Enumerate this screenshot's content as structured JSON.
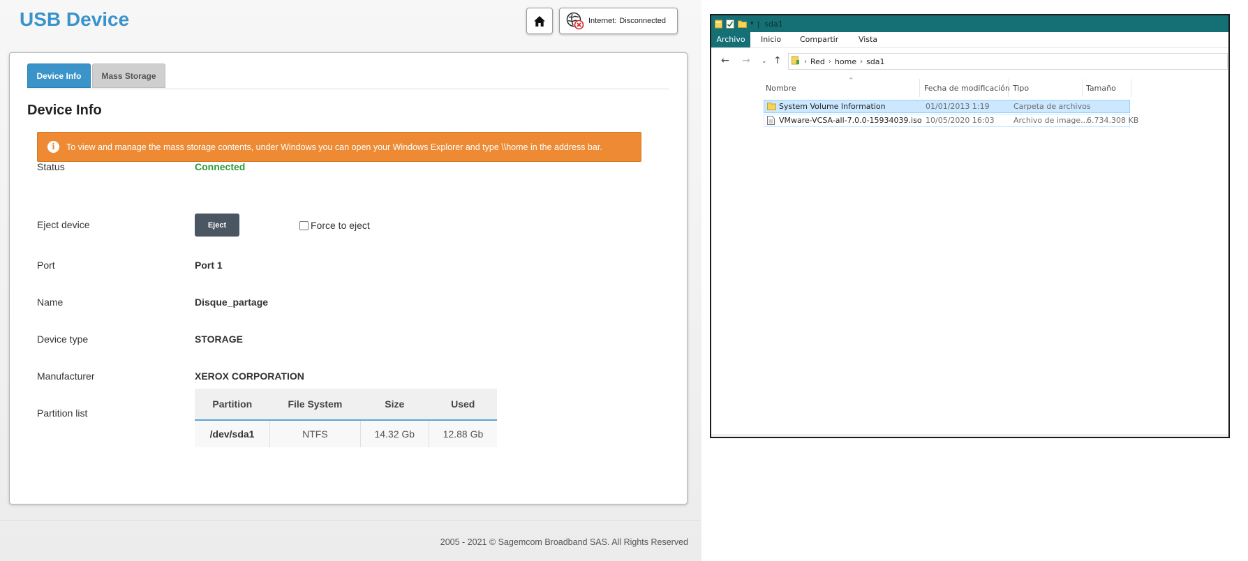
{
  "router": {
    "page_title": "USB Device",
    "home_icon": "home-icon",
    "internet": {
      "label": "Internet:",
      "status": "Disconnected",
      "icon": "globe-disconnected-icon"
    },
    "tabs": [
      {
        "label": "Device Info",
        "active": true
      },
      {
        "label": "Mass Storage",
        "active": false
      }
    ],
    "section_title": "Device Info",
    "alert": {
      "icon": "info-icon",
      "text": "To view and manage the mass storage contents, under Windows you can open your Windows Explorer and type \\\\home in the address bar."
    },
    "rows": {
      "status": {
        "label": "Status",
        "value": "Connected"
      },
      "eject": {
        "label": "Eject device",
        "button": "Eject",
        "checkbox_label": "Force to eject",
        "checkbox_checked": false
      },
      "port": {
        "label": "Port",
        "value": "Port 1"
      },
      "name": {
        "label": "Name",
        "value": "Disque_partage"
      },
      "device_type": {
        "label": "Device type",
        "value": "STORAGE"
      },
      "manufacturer": {
        "label": "Manufacturer",
        "value": "XEROX CORPORATION"
      },
      "partition_list": {
        "label": "Partition list"
      }
    },
    "partition_table": {
      "headers": [
        "Partition",
        "File System",
        "Size",
        "Used"
      ],
      "rows": [
        [
          "/dev/sda1",
          "NTFS",
          "14.32 Gb",
          "12.88 Gb"
        ]
      ]
    },
    "footer": "2005 - 2021 © Sagemcom Broadband SAS. All Rights Reserved",
    "colors": {
      "accent": "#3a93c9",
      "alert": "#ed8a33",
      "connected": "#2e9a36",
      "eject_button": "#4a5661"
    }
  },
  "explorer": {
    "window_title": "sda1",
    "ribbon_tabs": [
      "Archivo",
      "Inicio",
      "Compartir",
      "Vista"
    ],
    "nav": {
      "back_icon": "back-arrow-icon",
      "forward_icon": "forward-arrow-icon",
      "recent_icon": "chevron-down-icon",
      "up_icon": "up-arrow-icon"
    },
    "breadcrumb": [
      "Red",
      "home",
      "sda1"
    ],
    "columns": [
      "Nombre",
      "Fecha de modificación",
      "Tipo",
      "Tamaño"
    ],
    "files": [
      {
        "icon": "folder-icon",
        "name": "System Volume Information",
        "date": "01/01/2013 1:19",
        "type": "Carpeta de archivos",
        "size": "",
        "selected": true
      },
      {
        "icon": "file-icon",
        "name": "VMware-VCSA-all-7.0.0-15934039.iso",
        "date": "10/05/2020 16:03",
        "type": "Archivo de image...",
        "size": "6.734.308 KB",
        "selected": false
      }
    ],
    "colors": {
      "titlebar": "#157075",
      "selection": "#cce8ff"
    }
  }
}
